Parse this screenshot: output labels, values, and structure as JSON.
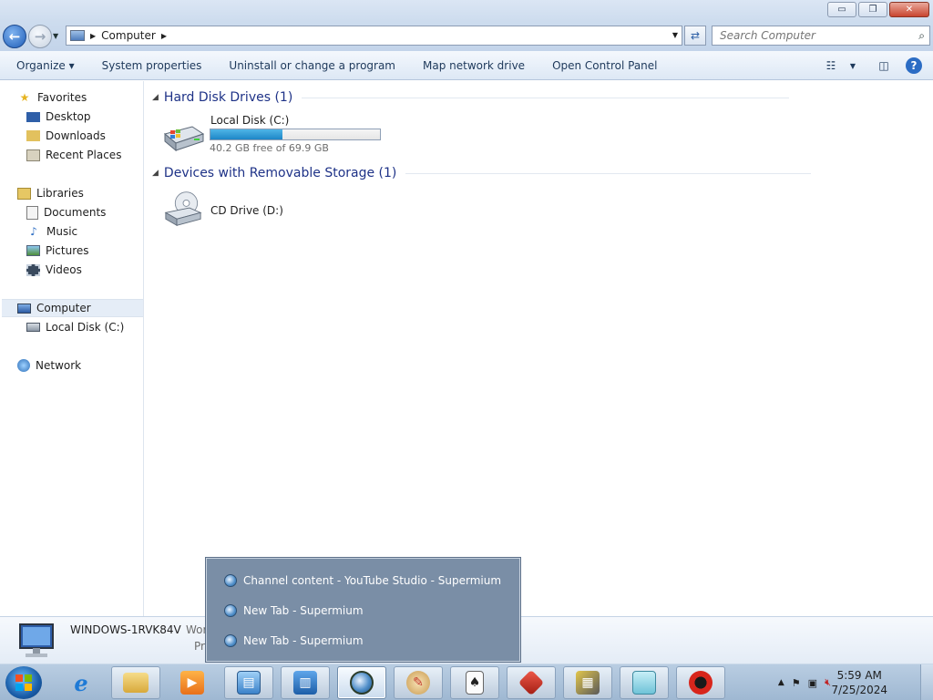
{
  "window": {
    "minimize": "▭",
    "restore": "❐",
    "close": "✕"
  },
  "address": {
    "path": "Computer",
    "search_placeholder": "Search Computer"
  },
  "toolbar": {
    "items": [
      "Organize ▾",
      "System properties",
      "Uninstall or change a program",
      "Map network drive",
      "Open Control Panel"
    ]
  },
  "nav": {
    "favorites": "Favorites",
    "desktop": "Desktop",
    "downloads": "Downloads",
    "recent_places": "Recent Places",
    "libraries": "Libraries",
    "documents": "Documents",
    "music": "Music",
    "pictures": "Pictures",
    "videos": "Videos",
    "computer": "Computer",
    "local_disk": "Local Disk (C:)",
    "network": "Network"
  },
  "content": {
    "hdd_group": "Hard Disk Drives (1)",
    "removable_group": "Devices with Removable Storage (1)",
    "local_disk": {
      "name": "Local Disk (C:)",
      "free_text": "40.2 GB free of 69.9 GB",
      "used_fraction": 0.425
    },
    "cd_drive": {
      "name": "CD Drive (D:)"
    }
  },
  "details": {
    "computer_name": "WINDOWS-1RVK84V",
    "workgroup_fragment": "Wor",
    "processor_fragment": "Pr"
  },
  "popup": {
    "items": [
      "Channel content - YouTube Studio - Supermium",
      "New Tab - Supermium",
      "New Tab - Supermium"
    ]
  },
  "clock": {
    "time": "5:59 AM",
    "date": "7/25/2024"
  },
  "colors": {
    "group_header": "#1e3287",
    "toolbar_text": "#1e395b",
    "popup_bg": "#7a8ea6",
    "disk_fill": "#1d86c7"
  }
}
